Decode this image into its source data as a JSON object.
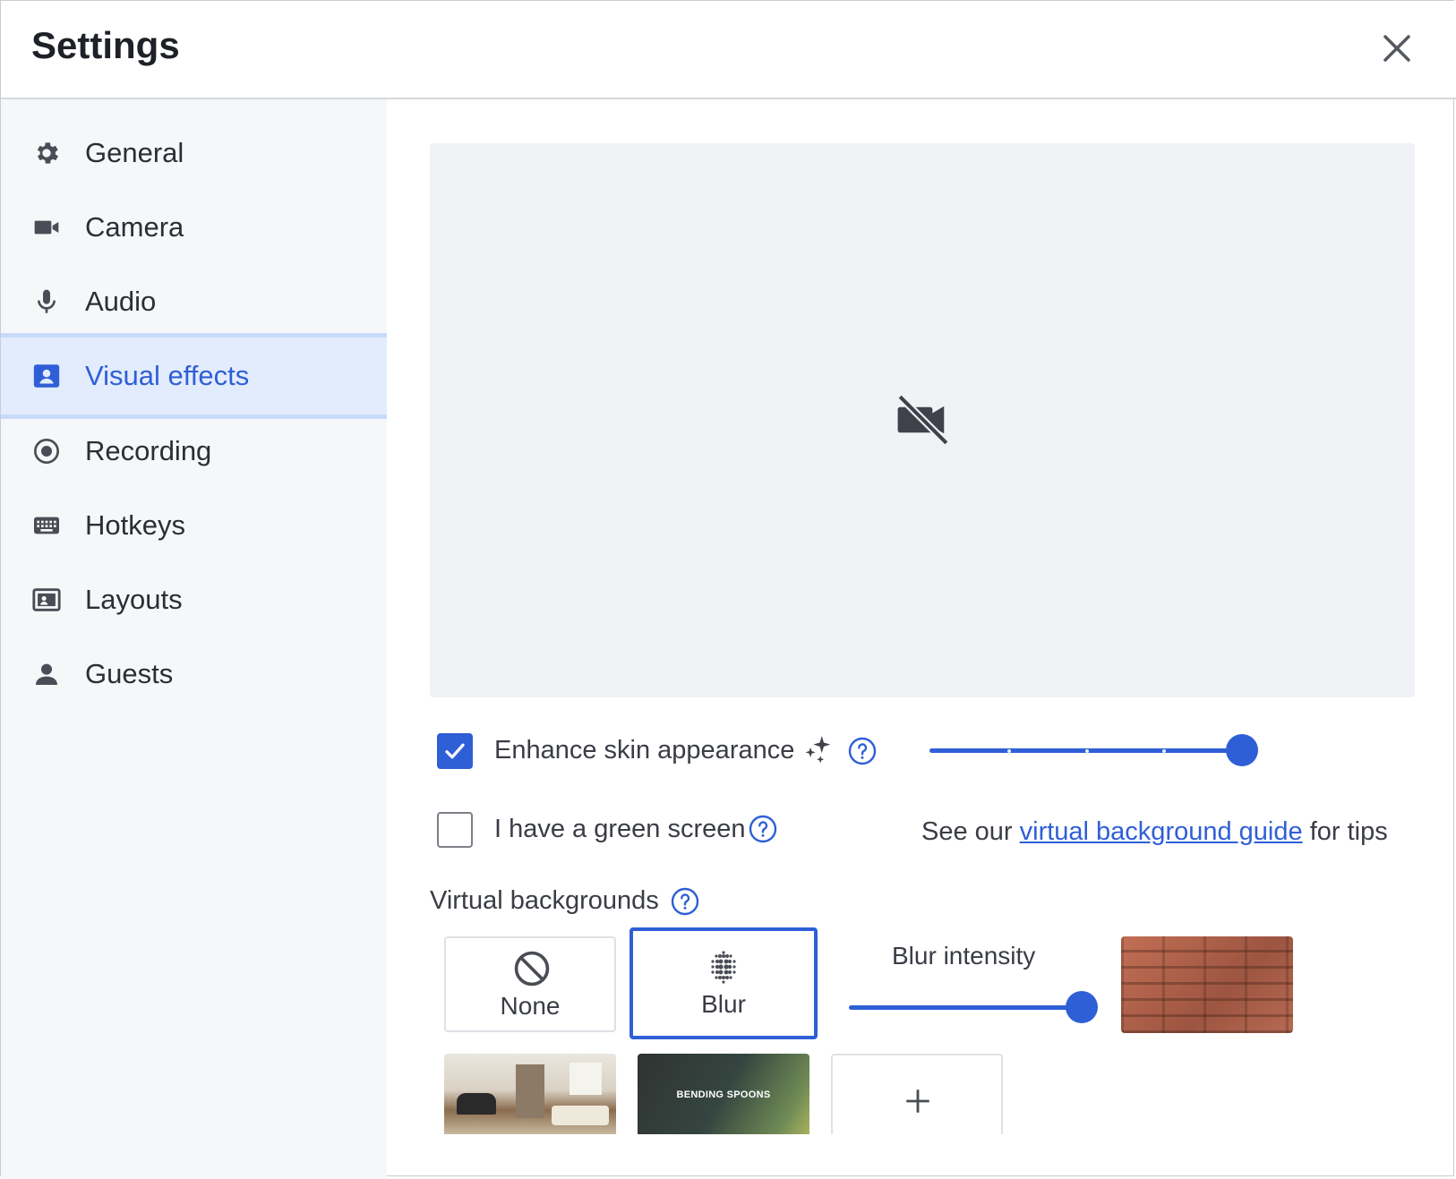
{
  "dialog": {
    "title": "Settings"
  },
  "sidebar": {
    "items": [
      {
        "id": "general",
        "label": "General",
        "icon": "gear-icon"
      },
      {
        "id": "camera",
        "label": "Camera",
        "icon": "video-camera-icon"
      },
      {
        "id": "audio",
        "label": "Audio",
        "icon": "microphone-icon"
      },
      {
        "id": "visual-effects",
        "label": "Visual effects",
        "icon": "person-card-icon",
        "active": true
      },
      {
        "id": "recording",
        "label": "Recording",
        "icon": "record-icon"
      },
      {
        "id": "hotkeys",
        "label": "Hotkeys",
        "icon": "keyboard-icon"
      },
      {
        "id": "layouts",
        "label": "Layouts",
        "icon": "layout-icon"
      },
      {
        "id": "guests",
        "label": "Guests",
        "icon": "person-icon"
      }
    ]
  },
  "main": {
    "preview": {
      "icon": "camera-off-icon"
    },
    "enhance_skin": {
      "label": "Enhance skin appearance",
      "checked": true,
      "icon": "sparkles-icon",
      "level": 1.0
    },
    "green_screen": {
      "label": "I have a green screen",
      "checked": false
    },
    "tips": {
      "prefix": "See our",
      "link": "virtual background guide",
      "suffix": "for tips"
    },
    "virtual_backgrounds": {
      "label": "Virtual backgrounds",
      "none_label": "None",
      "blur_label": "Blur",
      "selected": "Blur",
      "blur_intensity_label": "Blur intensity",
      "blur_intensity_level": 1.0,
      "brand_text": "BENDING SPOONS"
    }
  },
  "colors": {
    "accent": "#2f5fd7",
    "sidebar_bg": "#f6f7f9",
    "active_bg": "#e3ecfd"
  }
}
